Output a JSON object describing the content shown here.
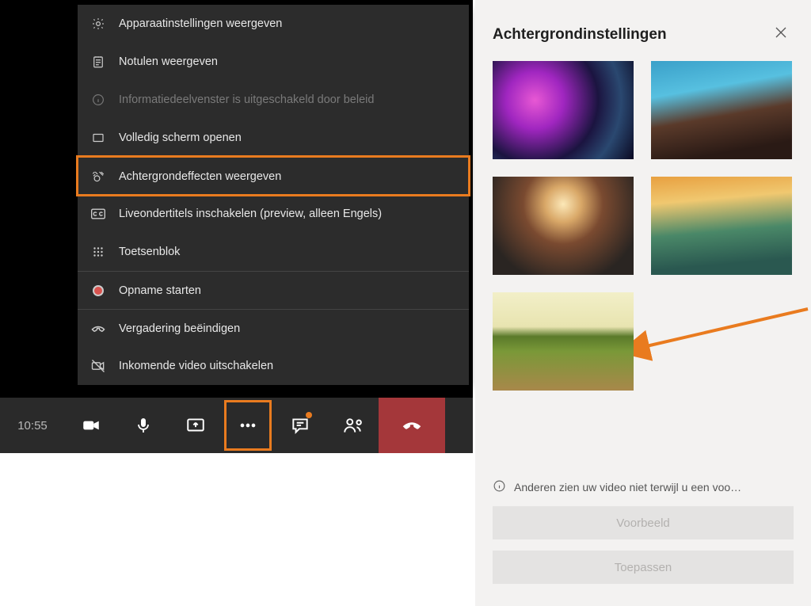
{
  "menu": {
    "device_settings": "Apparaatinstellingen weergeven",
    "meeting_notes": "Notulen weergeven",
    "info_pane_disabled": "Informatiedeelvenster is uitgeschakeld door beleid",
    "fullscreen": "Volledig scherm openen",
    "background_effects": "Achtergrondeffecten weergeven",
    "live_captions": "Liveondertitels inschakelen (preview, alleen Engels)",
    "keypad": "Toetsenblok",
    "start_recording": "Opname starten",
    "end_meeting": "Vergadering beëindigen",
    "disable_incoming_video": "Inkomende video uitschakelen"
  },
  "meeting_bar": {
    "time": "10:55"
  },
  "panel": {
    "title": "Achtergrondinstellingen",
    "info_text": "Anderen zien uw video niet terwijl u een voo…",
    "preview_button": "Voorbeeld",
    "apply_button": "Toepassen",
    "backgrounds": [
      {
        "id": "nebula",
        "class": "bg-nebula"
      },
      {
        "id": "planet",
        "class": "bg-planet"
      },
      {
        "id": "village",
        "class": "bg-village"
      },
      {
        "id": "sunset-figure",
        "class": "bg-sunset"
      },
      {
        "id": "green-field",
        "class": "bg-field"
      }
    ]
  },
  "highlight_color": "#e97b1f"
}
